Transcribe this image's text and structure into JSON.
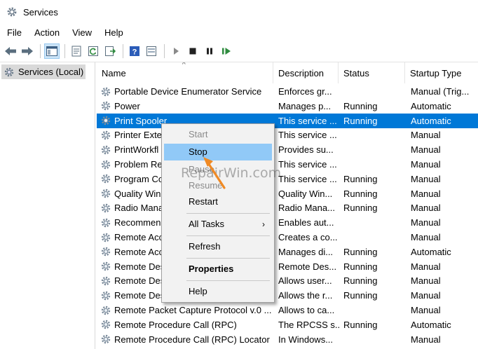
{
  "window": {
    "title": "Services",
    "icon": "gear-icon"
  },
  "menu": [
    {
      "label": "File"
    },
    {
      "label": "Action"
    },
    {
      "label": "View"
    },
    {
      "label": "Help"
    }
  ],
  "toolbar": {
    "icons": [
      "back-arrow-icon",
      "forward-arrow-icon",
      "show-hide-tree-icon",
      "properties-icon",
      "refresh-icon",
      "export-list-icon",
      "help-icon",
      "console-icon",
      "start-service-icon",
      "stop-service-icon",
      "pause-service-icon",
      "resume-service-icon"
    ]
  },
  "tree": {
    "selected_label": "Services (Local)"
  },
  "columns": {
    "name": "Name",
    "description": "Description",
    "status": "Status",
    "startup": "Startup Type"
  },
  "rows": [
    {
      "name": "Portable Device Enumerator Service",
      "description": "Enforces gr...",
      "status": "",
      "startup": "Manual (Trig..."
    },
    {
      "name": "Power",
      "description": "Manages p...",
      "status": "Running",
      "startup": "Automatic"
    },
    {
      "name": "Print Spooler",
      "description": "This service ...",
      "status": "Running",
      "startup": "Automatic"
    },
    {
      "name": "Printer Exte",
      "description": "This service ...",
      "status": "",
      "startup": "Manual"
    },
    {
      "name": "PrintWorkfl",
      "description": "Provides su...",
      "status": "",
      "startup": "Manual"
    },
    {
      "name": "Problem Re",
      "description": "This service ...",
      "status": "",
      "startup": "Manual"
    },
    {
      "name": "Program Co",
      "description": "This service ...",
      "status": "Running",
      "startup": "Manual"
    },
    {
      "name": "Quality Win",
      "description": "Quality Win...",
      "status": "Running",
      "startup": "Manual"
    },
    {
      "name": "Radio Mana",
      "description": "Radio Mana...",
      "status": "Running",
      "startup": "Manual"
    },
    {
      "name": "Recommen",
      "description": "Enables aut...",
      "status": "",
      "startup": "Manual"
    },
    {
      "name": "Remote Acc",
      "description": "Creates a co...",
      "status": "",
      "startup": "Manual"
    },
    {
      "name": "Remote Acc",
      "description": "Manages di...",
      "status": "Running",
      "startup": "Automatic"
    },
    {
      "name": "Remote Des",
      "description": "Remote Des...",
      "status": "Running",
      "startup": "Manual"
    },
    {
      "name": "Remote Des",
      "description": "Allows user...",
      "status": "Running",
      "startup": "Manual"
    },
    {
      "name": "Remote Des",
      "description": "Allows the r...",
      "status": "Running",
      "startup": "Manual"
    },
    {
      "name": "Remote Packet Capture Protocol v.0 ...",
      "description": "Allows to ca...",
      "status": "",
      "startup": "Manual"
    },
    {
      "name": "Remote Procedure Call (RPC)",
      "description": "The RPCSS s...",
      "status": "Running",
      "startup": "Automatic"
    },
    {
      "name": "Remote Procedure Call (RPC) Locator",
      "description": "In Windows...",
      "status": "",
      "startup": "Manual"
    }
  ],
  "selected_row_index": 2,
  "context_menu": {
    "items": [
      {
        "label": "Start",
        "state": "disabled"
      },
      {
        "label": "Stop",
        "state": "hover"
      },
      {
        "label": "Pause",
        "state": "disabled"
      },
      {
        "label": "Resume",
        "state": "disabled"
      },
      {
        "label": "Restart",
        "state": "normal"
      },
      {
        "label": "All Tasks",
        "state": "normal",
        "submenu": true
      },
      {
        "label": "Refresh",
        "state": "normal"
      },
      {
        "label": "Properties",
        "state": "bold"
      },
      {
        "label": "Help",
        "state": "normal"
      }
    ],
    "submenu_glyph": "›"
  },
  "watermark": "RepairWin.com",
  "colors": {
    "selection": "#0078d7",
    "menu_hover": "#91c9f7",
    "pointer_arrow": "#f08a24"
  }
}
